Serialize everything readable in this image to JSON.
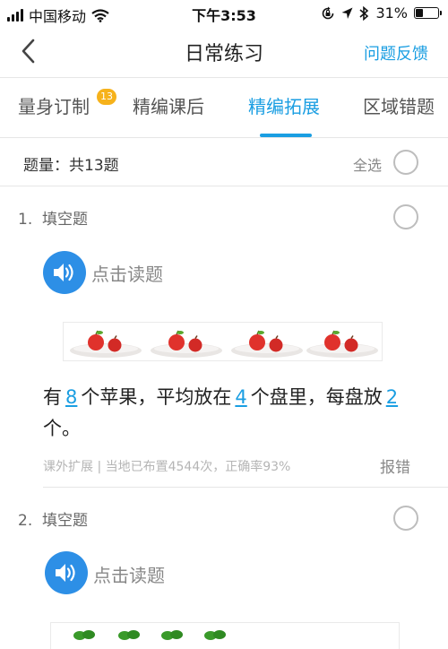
{
  "status_bar": {
    "carrier": "中国移动",
    "time": "下午3:53",
    "battery_text": "31%",
    "battery_level": 0.31,
    "icons": [
      "signal-icon",
      "wifi-icon",
      "rotation-lock-icon",
      "location-icon",
      "bluetooth-icon",
      "battery-icon"
    ]
  },
  "header": {
    "title": "日常练习",
    "feedback": "问题反馈"
  },
  "tabs": [
    {
      "label": "量身订制",
      "badge": "13"
    },
    {
      "label": "精编课后"
    },
    {
      "label": "精编拓展",
      "active": true
    },
    {
      "label": "区域错题"
    }
  ],
  "summary": {
    "count_label": "题量：共13题",
    "select_all": "全选"
  },
  "questions": [
    {
      "number": "1.",
      "type": "填空题",
      "read_label": "点击读题",
      "text_parts": [
        "有",
        "8",
        "个苹果，平均放在",
        "4",
        "个盘里，每盘放",
        "2",
        "个。"
      ],
      "meta": "课外扩展 | 当地已布置4544次，正确率93%",
      "report": "报错"
    },
    {
      "number": "2.",
      "type": "填空题",
      "read_label": "点击读题"
    }
  ],
  "colors": {
    "accent": "#1a9ee2",
    "badge": "#f6b21b",
    "speaker": "#2d8fe6"
  }
}
